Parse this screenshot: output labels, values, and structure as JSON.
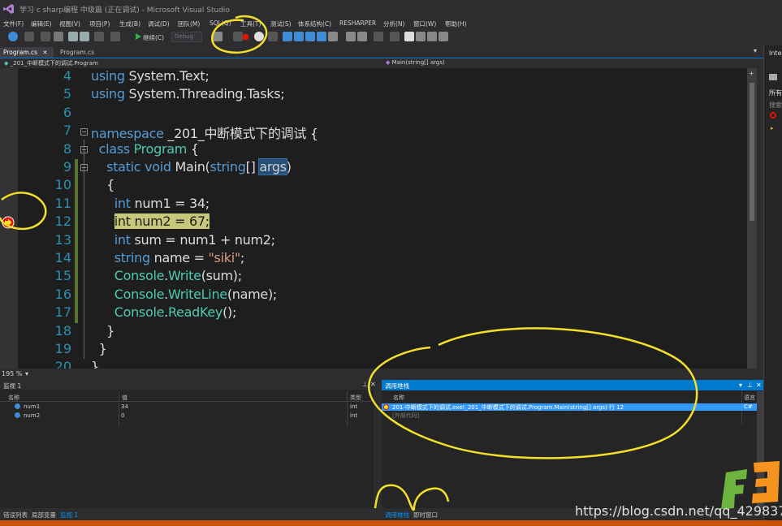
{
  "window": {
    "title": "学习 c sharp编程 中级篇 (正在调试) - Microsoft Visual Studio"
  },
  "menu": [
    "文件(F)",
    "编辑(E)",
    "视图(V)",
    "项目(P)",
    "生成(B)",
    "调试(D)",
    "团队(M)",
    "SQL(Q)",
    "工具(T)",
    "测试(S)",
    "体系结构(C)",
    "RESHARPER",
    "分析(N)",
    "窗口(W)",
    "帮助(H)"
  ],
  "toolbar": {
    "continue_label": "继续(C)",
    "config_value": "Debug"
  },
  "tabs": [
    {
      "label": "Program.cs",
      "active": true
    },
    {
      "label": "Program.cs",
      "active": false
    }
  ],
  "navbar": {
    "left": "_201_中断模式下的调试.Program",
    "right": "Main(string[] args)"
  },
  "editor": {
    "zoom": "195 %",
    "lines": [
      {
        "num": "4",
        "tokens": [
          [
            "kw",
            "using"
          ],
          [
            "pl",
            " System.Text;"
          ]
        ]
      },
      {
        "num": "5",
        "tokens": [
          [
            "kw",
            "using"
          ],
          [
            "pl",
            " System.Threading.Tasks;"
          ]
        ]
      },
      {
        "num": "6",
        "tokens": []
      },
      {
        "num": "7",
        "tokens": [
          [
            "kw",
            "namespace"
          ],
          [
            "pl",
            " _201_中断模式下的调试 {"
          ]
        ]
      },
      {
        "num": "8",
        "tokens": [
          [
            "pl",
            "  "
          ],
          [
            "kw",
            "class"
          ],
          [
            "pl",
            " "
          ],
          [
            "ty",
            "Program"
          ],
          [
            "pl",
            " {"
          ]
        ]
      },
      {
        "num": "9",
        "tokens": [
          [
            "pl",
            "    "
          ],
          [
            "kw",
            "static"
          ],
          [
            "pl",
            " "
          ],
          [
            "kw",
            "void"
          ],
          [
            "pl",
            " Main("
          ],
          [
            "kw",
            "string"
          ],
          [
            "pl",
            "[] "
          ],
          [
            "sel",
            "args"
          ],
          [
            "pl",
            ")"
          ]
        ]
      },
      {
        "num": "10",
        "tokens": [
          [
            "pl",
            "    {"
          ]
        ]
      },
      {
        "num": "11",
        "tokens": [
          [
            "pl",
            "      "
          ],
          [
            "kw",
            "int"
          ],
          [
            "pl",
            " num1 = 34;"
          ]
        ]
      },
      {
        "num": "12",
        "tokens": [
          [
            "pl",
            "      "
          ],
          [
            "hl",
            "int num2 = 67;"
          ]
        ]
      },
      {
        "num": "13",
        "tokens": [
          [
            "pl",
            "      "
          ],
          [
            "kw",
            "int"
          ],
          [
            "pl",
            " sum = num1 + num2;"
          ]
        ]
      },
      {
        "num": "14",
        "tokens": [
          [
            "pl",
            "      "
          ],
          [
            "kw",
            "string"
          ],
          [
            "pl",
            " name = "
          ],
          [
            "st",
            "\"siki\""
          ],
          [
            "pl",
            ";"
          ]
        ]
      },
      {
        "num": "15",
        "tokens": [
          [
            "pl",
            "      "
          ],
          [
            "ty",
            "Console"
          ],
          [
            "pl",
            "."
          ],
          [
            "ty",
            "Write"
          ],
          [
            "pl",
            "(sum);"
          ]
        ]
      },
      {
        "num": "16",
        "tokens": [
          [
            "pl",
            "      "
          ],
          [
            "ty",
            "Console"
          ],
          [
            "pl",
            "."
          ],
          [
            "ty",
            "WriteLine"
          ],
          [
            "pl",
            "(name);"
          ]
        ]
      },
      {
        "num": "17",
        "tokens": [
          [
            "pl",
            "      "
          ],
          [
            "ty",
            "Console"
          ],
          [
            "pl",
            "."
          ],
          [
            "ty",
            "ReadKey"
          ],
          [
            "pl",
            "();"
          ]
        ]
      },
      {
        "num": "18",
        "tokens": [
          [
            "pl",
            "    }"
          ]
        ]
      },
      {
        "num": "19",
        "tokens": [
          [
            "pl",
            "  }"
          ]
        ]
      },
      {
        "num": "20",
        "tokens": [
          [
            "pl",
            "}"
          ]
        ]
      }
    ]
  },
  "watch": {
    "title": "监视 1",
    "columns": [
      "名称",
      "值",
      "类型"
    ],
    "rows": [
      {
        "name": "num1",
        "value": "34",
        "type": "int"
      },
      {
        "name": "num2",
        "value": "0",
        "type": "int"
      }
    ]
  },
  "callstack": {
    "title": "调用堆栈",
    "columns": [
      "名称",
      "语言"
    ],
    "rows": [
      {
        "name": "201-中断模式下的调试.exe!_201_中断模式下的调试.Program.Main(string[] args) 行 12",
        "lang": "C#"
      },
      {
        "name": "[外部代码]",
        "lang": ""
      }
    ]
  },
  "bottom_tabs_left": [
    "错误列表",
    "局部变量",
    "监视 1"
  ],
  "bottom_tabs_right": [
    "调用堆栈",
    "即时窗口"
  ],
  "right_strip": [
    "Intel",
    "所有",
    "搜索"
  ],
  "watermark": "https://blog.csdn.net/qq_42983775",
  "colors": {
    "accent": "#007acc",
    "status_bar": "#ca5100",
    "current_line_highlight": "#c8c87a",
    "annotation": "#f2e02a"
  }
}
